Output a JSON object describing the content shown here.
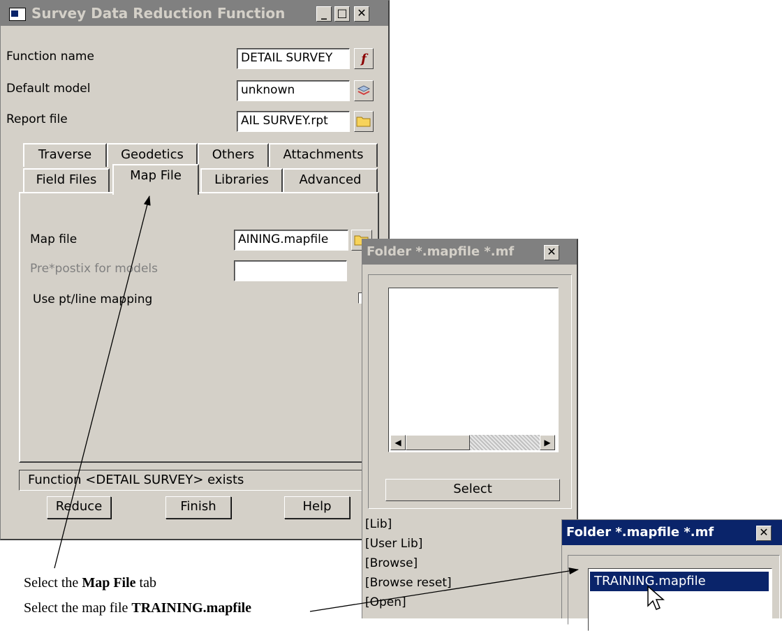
{
  "main_window": {
    "title": "Survey Data Reduction Function",
    "buttons": {
      "minimize": "_",
      "maximize": "□",
      "close": "✕"
    },
    "fields": {
      "function_name": {
        "label": "Function name",
        "value": "DETAIL SURVEY"
      },
      "default_model": {
        "label": "Default model",
        "value": "unknown"
      },
      "report_file": {
        "label": "Report file",
        "value": "AIL SURVEY.rpt"
      }
    },
    "tabs_row1": [
      "Traverse",
      "Geodetics",
      "Others",
      "Attachments"
    ],
    "tabs_row2": [
      "Field Files",
      "Map File",
      "Libraries",
      "Advanced"
    ],
    "active_tab": "Map File",
    "map_tab": {
      "map_file": {
        "label": "Map file",
        "value": "AINING.mapfile"
      },
      "prefix": {
        "label": "Pre*postix for models",
        "value": ""
      },
      "use_mapping": {
        "label": "Use pt/line mapping",
        "checked": false
      }
    },
    "status": "Function <DETAIL SURVEY> exists",
    "actions": {
      "reduce": "Reduce",
      "finish": "Finish",
      "help": "Help"
    }
  },
  "folder_window": {
    "title": "Folder *.mapfile *.mf",
    "close": "✕",
    "select_button": "Select",
    "menu_items": [
      "[Lib]",
      "[User Lib]",
      "[Browse]",
      "[Browse reset]",
      "[Open]"
    ]
  },
  "folder_window_2": {
    "title": "Folder *.mapfile *.mf",
    "close": "✕",
    "selected_item": "TRAINING.mapfile"
  },
  "annotations": {
    "note1_prefix": "Select the ",
    "note1_bold": "Map File",
    "note1_suffix": " tab",
    "note2_prefix": "Select the map file ",
    "note2_bold": "TRAINING.mapfile"
  },
  "colors": {
    "title_inactive": "#808080",
    "face": "#d4d0c8",
    "selection": "#0a246a"
  }
}
